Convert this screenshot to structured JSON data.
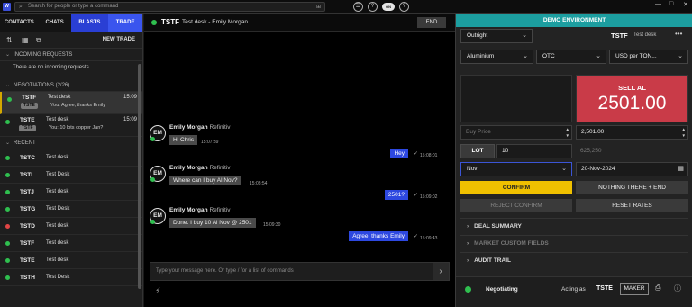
{
  "titlebar": {
    "logo": "W",
    "search_placeholder": "Search for people or type a command",
    "search_shortcut": "⊞",
    "icons": [
      "chat-icon",
      "help-icon",
      "toggle-icon",
      "question-icon"
    ],
    "toggle_label": "ON",
    "window_controls": [
      "—",
      "□",
      "✕"
    ]
  },
  "left": {
    "tabs": [
      {
        "label": "CONTACTS",
        "active": false
      },
      {
        "label": "CHATS",
        "active": false
      },
      {
        "label": "BLASTS",
        "active": true
      },
      {
        "label": "TRADE",
        "active": true
      }
    ],
    "new_trade_label": "NEW TRADE",
    "incoming": {
      "header": "INCOMING REQUESTS",
      "empty_text": "There are no incoming requests"
    },
    "negotiations": {
      "header": "NEGOTIATIONS (2/26)",
      "items": [
        {
          "code": "TSTF",
          "name": "Test desk",
          "tag": "TSTE",
          "message": "You: Agree, thanks Emily",
          "time": "15:09"
        },
        {
          "code": "TSTE",
          "name": "Test desk",
          "tag": "TSTF",
          "message": "You: 10 lots copper Jan?",
          "time": "15:09"
        }
      ]
    },
    "recent": {
      "header": "RECENT",
      "items": [
        {
          "code": "TSTC",
          "name": "Test desk",
          "status": "green"
        },
        {
          "code": "TSTI",
          "name": "Test Desk",
          "status": "green"
        },
        {
          "code": "TSTJ",
          "name": "Test desk",
          "status": "green"
        },
        {
          "code": "TSTG",
          "name": "Test Desk",
          "status": "green"
        },
        {
          "code": "TSTD",
          "name": "Test desk",
          "status": "red"
        },
        {
          "code": "TSTF",
          "name": "Test desk",
          "status": "green"
        },
        {
          "code": "TSTE",
          "name": "Test desk",
          "status": "green"
        },
        {
          "code": "TSTH",
          "name": "Test Desk",
          "status": "green"
        }
      ]
    }
  },
  "chat": {
    "header_code": "TSTF",
    "header_title": "Test desk - Emily Morgan",
    "end_label": "END",
    "sender_name": "Emily Morgan",
    "sender_org": "Refinitiv",
    "avatar_initials": "EM",
    "messages_in": [
      {
        "text": "Hi Chris",
        "time": "15:07:39"
      },
      {
        "text": "Where can I buy Al Nov?",
        "time": "15:08:54"
      },
      {
        "text": "Done. I buy 10 Al Nov @ 2501",
        "time": "15:09:30"
      }
    ],
    "messages_out": [
      {
        "text": "Hey",
        "time": "15:08:01"
      },
      {
        "text": "2501?",
        "time": "15:09:02"
      },
      {
        "text": "Agree, thanks Emily",
        "time": "15:09:43"
      }
    ],
    "check_mark": "✓",
    "input_placeholder": "Type your message here. Or type / for a list of commands",
    "send_icon": "›",
    "bolt_icon": "⚡"
  },
  "right": {
    "banner": "DEMO ENVIRONMENT",
    "trade_type": "Outright",
    "header_code": "TSTF",
    "header_desk": "Test desk",
    "menu_glyph": "•••",
    "commodity": "Aluminium",
    "venue": "OTC",
    "unit": "USD per TON...",
    "buy_placeholder_dots": "...",
    "sell_label": "SELL AL",
    "sell_price": "2501.00",
    "buy_price_placeholder": "Buy Price",
    "sell_price_field": "2,501.00",
    "lot_label": "LOT",
    "lot_value": "10",
    "notional": "625,250",
    "period": "Nov",
    "date": "20-Nov-2024",
    "confirm_label": "CONFIRM",
    "nothing_label": "NOTHING THERE + END",
    "reject_label": "REJECT CONFIRM",
    "reset_label": "RESET RATES",
    "accordions": [
      {
        "label": "DEAL SUMMARY",
        "dim": false
      },
      {
        "label": "MARKET CUSTOM FIELDS",
        "dim": true
      },
      {
        "label": "AUDIT TRAIL",
        "dim": false
      }
    ],
    "footer": {
      "status": "Negotiating",
      "acting_as": "Acting as",
      "acting_code": "TSTE",
      "role": "MAKER",
      "icons": [
        "print-icon",
        "info-icon"
      ]
    }
  },
  "colors": {
    "accent_blue": "#2a3fd4",
    "demo_teal": "#1c9ea0",
    "sell_red": "#c93b48",
    "confirm_yellow": "#f0c000",
    "online_green": "#2fbf4f"
  }
}
